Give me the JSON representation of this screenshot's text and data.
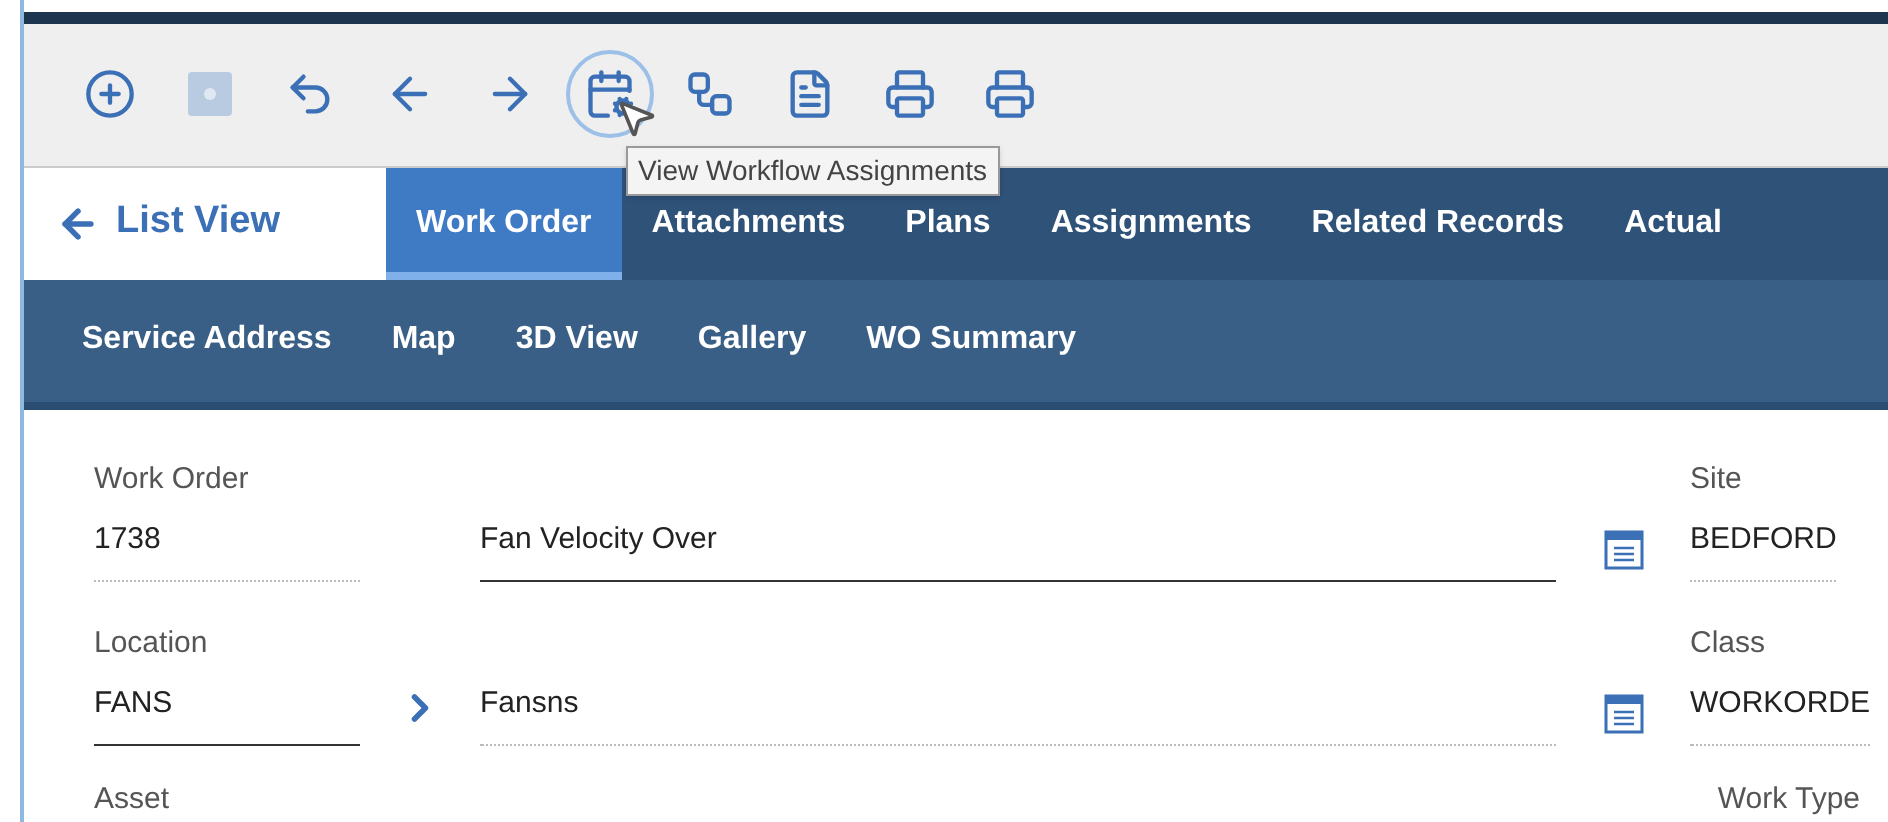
{
  "tooltip": "View Workflow Assignments",
  "back_link": "List View",
  "tabs": [
    {
      "label": "Work Order",
      "selected": true
    },
    {
      "label": "Attachments",
      "selected": false
    },
    {
      "label": "Plans",
      "selected": false
    },
    {
      "label": "Assignments",
      "selected": false
    },
    {
      "label": "Related Records",
      "selected": false
    },
    {
      "label": "Actual",
      "selected": false
    }
  ],
  "subtabs": [
    "Service Address",
    "Map",
    "3D View",
    "Gallery",
    "WO Summary"
  ],
  "fields": [
    {
      "label": "Work Order",
      "value": "1738",
      "editable": false,
      "description": "Fan Velocity Over",
      "description_editable": true,
      "side_label": "Site",
      "side_value": "BEDFORD"
    },
    {
      "label": "Location",
      "value": "FANS",
      "editable": true,
      "description": "Fansns",
      "description_editable": false,
      "side_label": "Class",
      "side_value": "WORKORDE"
    }
  ],
  "next_labels": [
    "Asset",
    "Work Type"
  ]
}
